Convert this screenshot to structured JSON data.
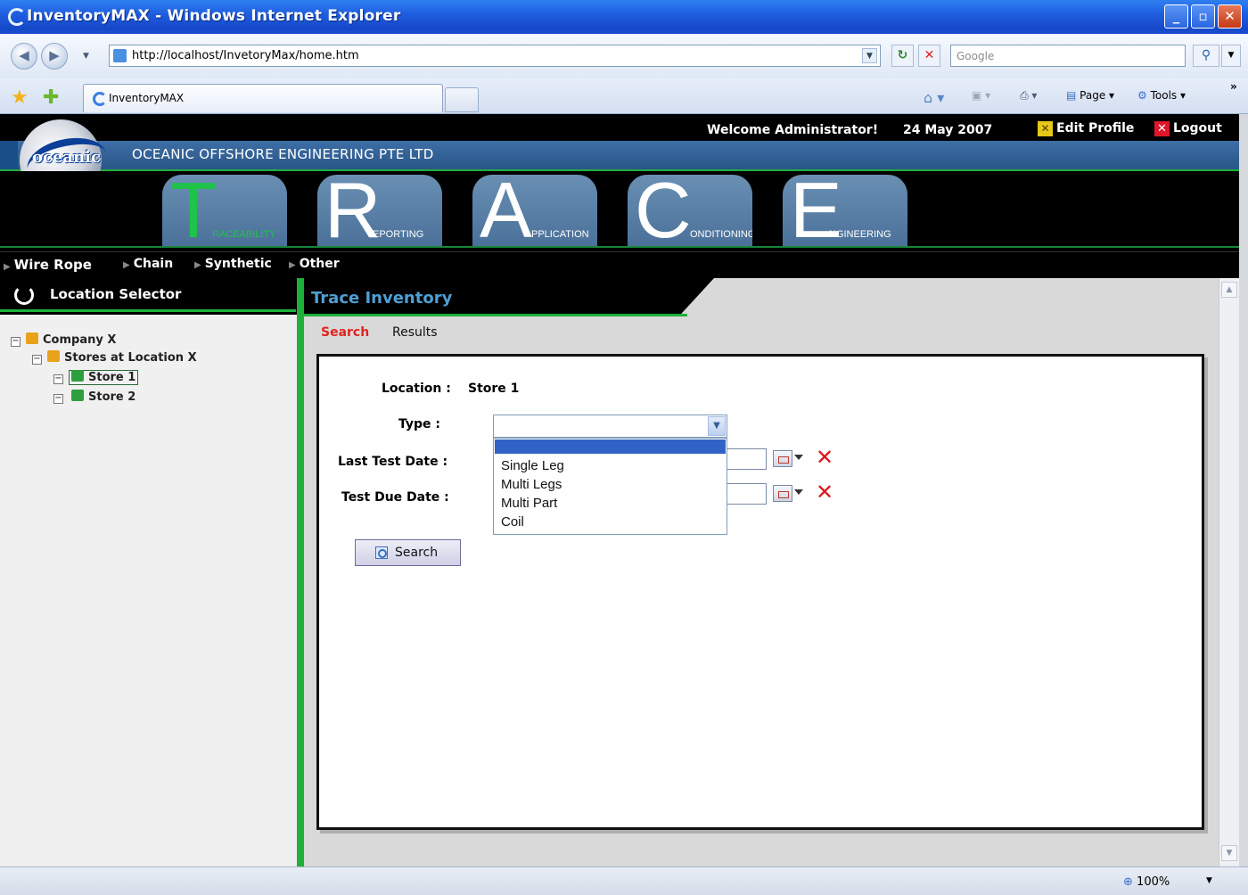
{
  "browser": {
    "window_title": "InventoryMAX - Windows Internet Explorer",
    "url": "http://localhost/InvetoryMax/home.htm",
    "search_placeholder": "Google",
    "tab_title": "InventoryMAX",
    "commands": {
      "page": "Page",
      "tools": "Tools"
    },
    "zoom": "100%"
  },
  "header": {
    "logo_text": "oceanic",
    "company_name": "OCEANIC OFFSHORE ENGINEERING PTE LTD",
    "welcome": "Welcome Administrator!",
    "date": "24 May 2007",
    "edit_profile": "Edit Profile",
    "logout": "Logout"
  },
  "trace_tabs": [
    {
      "letter": "T",
      "rest": "RACEABILITY",
      "active": true
    },
    {
      "letter": "R",
      "rest": "EPORTING",
      "active": false
    },
    {
      "letter": "A",
      "rest": "PPLICATION",
      "active": false
    },
    {
      "letter": "C",
      "rest": "ONDITIONING",
      "active": false
    },
    {
      "letter": "E",
      "rest": "NGINEERING",
      "active": false
    }
  ],
  "categories": [
    "Wire Rope",
    "Chain",
    "Synthetic",
    "Other"
  ],
  "location_selector": {
    "title": "Location Selector",
    "tree": [
      {
        "label": "Company X",
        "level": 0,
        "icon": "folder-icon"
      },
      {
        "label": "Stores at Location X",
        "level": 1,
        "icon": "folder-icon"
      },
      {
        "label": "Store 1",
        "level": 2,
        "icon": "store-icon",
        "selected": true
      },
      {
        "label": "Store 2",
        "level": 2,
        "icon": "store-icon",
        "selected": false
      }
    ]
  },
  "trace_inventory": {
    "title": "Trace Inventory",
    "subtabs": {
      "search": "Search",
      "results": "Results"
    },
    "form": {
      "location_label": "Location :",
      "location_value": "Store 1",
      "type_label": "Type :",
      "type_selected": "",
      "type_options": [
        "",
        "Single Leg",
        "Multi Legs",
        "Multi Part",
        "Coil"
      ],
      "last_test_label": "Last Test Date :",
      "test_due_label": "Test Due Date :",
      "search_button": "Search"
    }
  }
}
